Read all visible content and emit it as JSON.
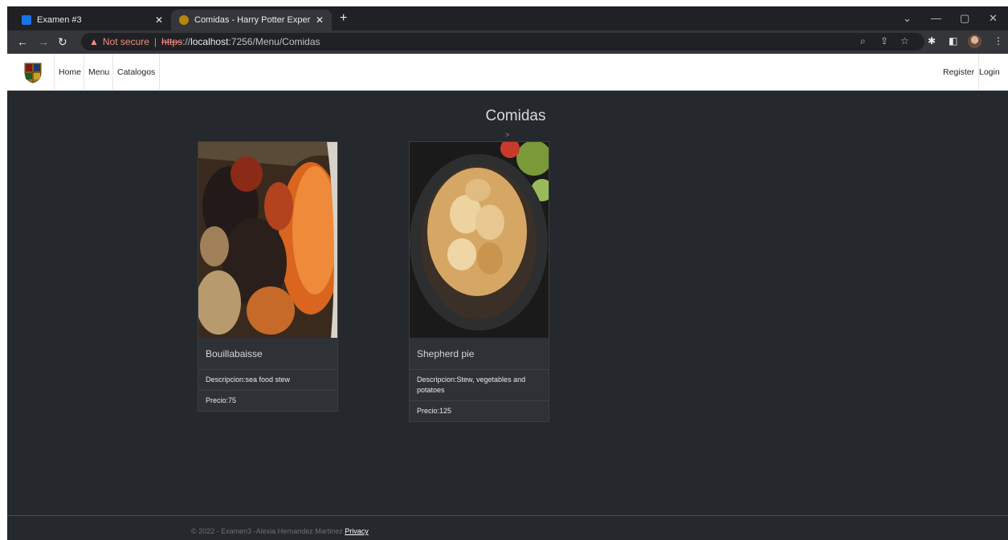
{
  "browser": {
    "tabs": [
      {
        "title": "Examen #3",
        "active": false
      },
      {
        "title": "Comidas - Harry Potter Experienc",
        "active": true
      }
    ],
    "address": {
      "security_label": "Not secure",
      "scheme": "https",
      "host_rest": "://",
      "host": "localhost",
      "path": ":7256/Menu/Comidas"
    }
  },
  "navbar": {
    "links": [
      "Home",
      "Menu",
      "Catalogos"
    ],
    "right_links": [
      "Register",
      "Login"
    ]
  },
  "main": {
    "title": "Comidas",
    "arrow": ">",
    "cards": [
      {
        "name": "Bouillabaisse",
        "description": "Descripcion:sea food stew",
        "price": "Precio:75"
      },
      {
        "name": "Shepherd pie",
        "description": "Descripcion:Stew, vegetables and potatoes",
        "price": "Precio:125"
      }
    ]
  },
  "footer": {
    "text": "© 2022 - Examen3 -Alexia Hernandez Martinez",
    "privacy": "Privacy"
  },
  "colors": {
    "page_bg": "#25282c",
    "card_bg": "#2e3236",
    "chrome_bg": "#202124",
    "warning_red": "#f28b82"
  }
}
